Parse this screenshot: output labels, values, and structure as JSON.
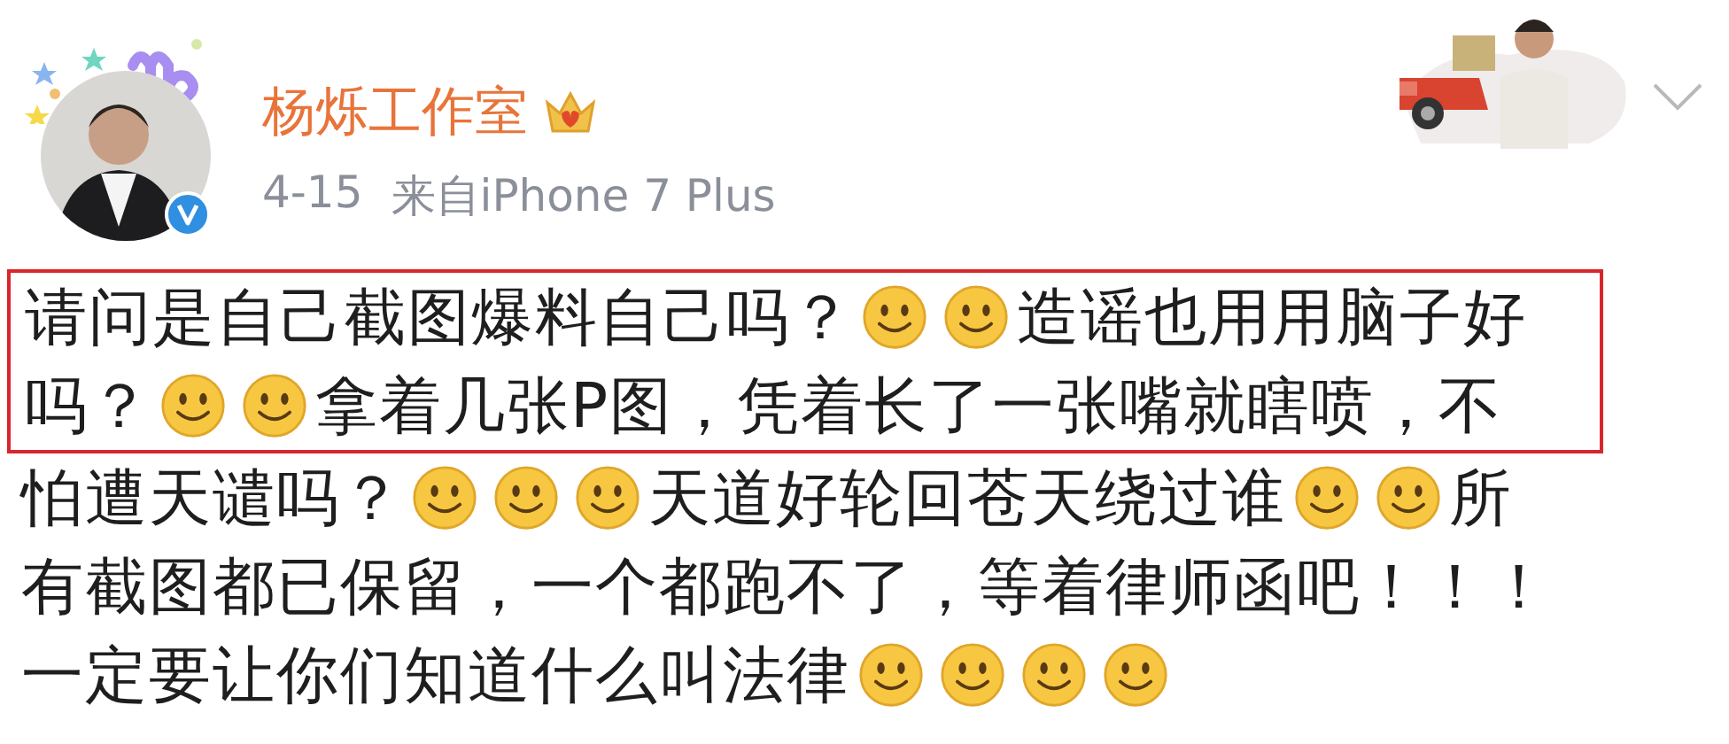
{
  "post": {
    "author": "杨烁工作室",
    "date": "4-15",
    "source": "来自iPhone 7 Plus",
    "lines": [
      {
        "highlighted": true,
        "segments": [
          {
            "kind": "text",
            "text": "请问是自己截图爆料自己吗？"
          },
          {
            "kind": "emoji"
          },
          {
            "kind": "emoji"
          },
          {
            "kind": "text",
            "text": "造谣也用用脑子好"
          }
        ]
      },
      {
        "highlighted": true,
        "segments": [
          {
            "kind": "text",
            "text": "吗？"
          },
          {
            "kind": "emoji"
          },
          {
            "kind": "emoji"
          },
          {
            "kind": "text",
            "text": "拿着几张P图，凭着长了一张嘴就瞎喷，不"
          }
        ]
      },
      {
        "highlighted": false,
        "segments": [
          {
            "kind": "text",
            "text": "怕遭天谴吗？"
          },
          {
            "kind": "emoji"
          },
          {
            "kind": "emoji"
          },
          {
            "kind": "emoji"
          },
          {
            "kind": "text",
            "text": "天道好轮回苍天绕过谁"
          },
          {
            "kind": "emoji"
          },
          {
            "kind": "emoji"
          },
          {
            "kind": "text",
            "text": "所"
          }
        ]
      },
      {
        "highlighted": false,
        "segments": [
          {
            "kind": "text",
            "text": "有截图都已保留，一个都跑不了，等着律师函吧！！！"
          }
        ]
      },
      {
        "highlighted": false,
        "segments": [
          {
            "kind": "text",
            "text": "一定要让你们知道什么叫法律"
          },
          {
            "kind": "emoji"
          },
          {
            "kind": "emoji"
          },
          {
            "kind": "emoji"
          },
          {
            "kind": "emoji"
          }
        ]
      }
    ]
  }
}
